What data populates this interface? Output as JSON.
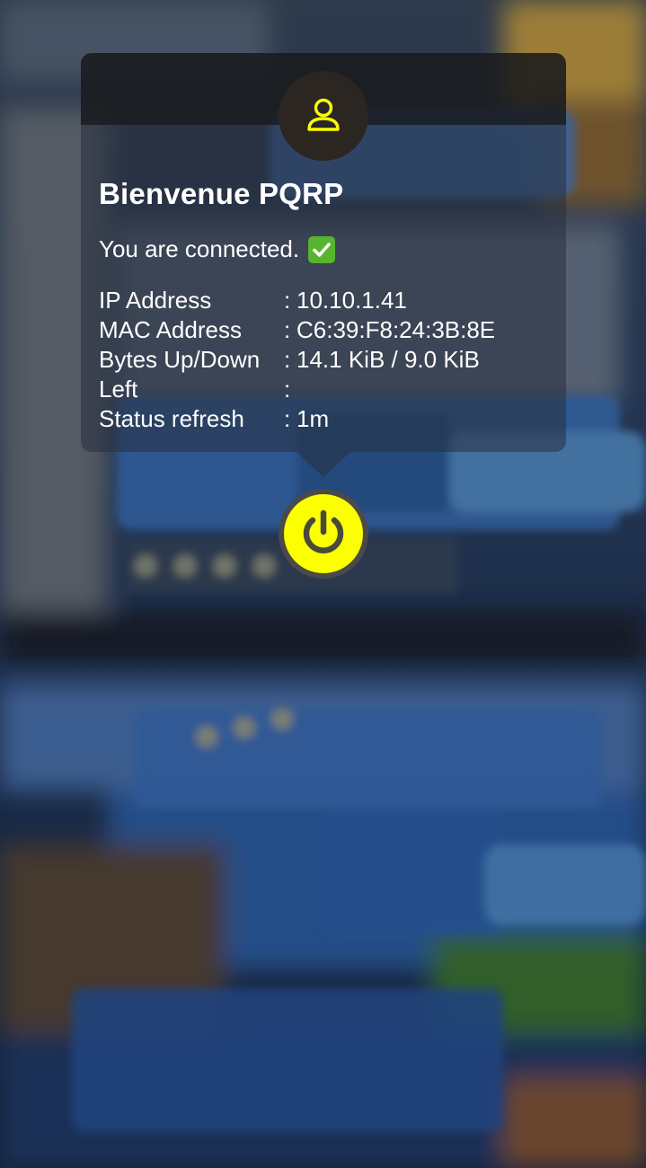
{
  "header": {
    "welcome": "Bienvenue PQRP",
    "avatar_icon": "user-icon"
  },
  "status": {
    "message": "You are connected.",
    "icon": "check-mark-icon"
  },
  "info": {
    "rows": [
      {
        "label": "IP Address",
        "sep": ":",
        "value": "10.10.1.41"
      },
      {
        "label": "MAC Address",
        "sep": ":",
        "value": "C6:39:F8:24:3B:8E"
      },
      {
        "label": "Bytes Up/Down",
        "sep": ":",
        "value": "14.1 KiB / 9.0 KiB"
      },
      {
        "label": "Left",
        "sep": ":",
        "value": ""
      },
      {
        "label": "Status refresh",
        "sep": ":",
        "value": "1m"
      }
    ]
  },
  "controls": {
    "power_icon": "power-icon"
  },
  "colors": {
    "accent": "#fbff00",
    "card": "#28303e",
    "text": "#ffffff",
    "check": "#57b42f"
  }
}
